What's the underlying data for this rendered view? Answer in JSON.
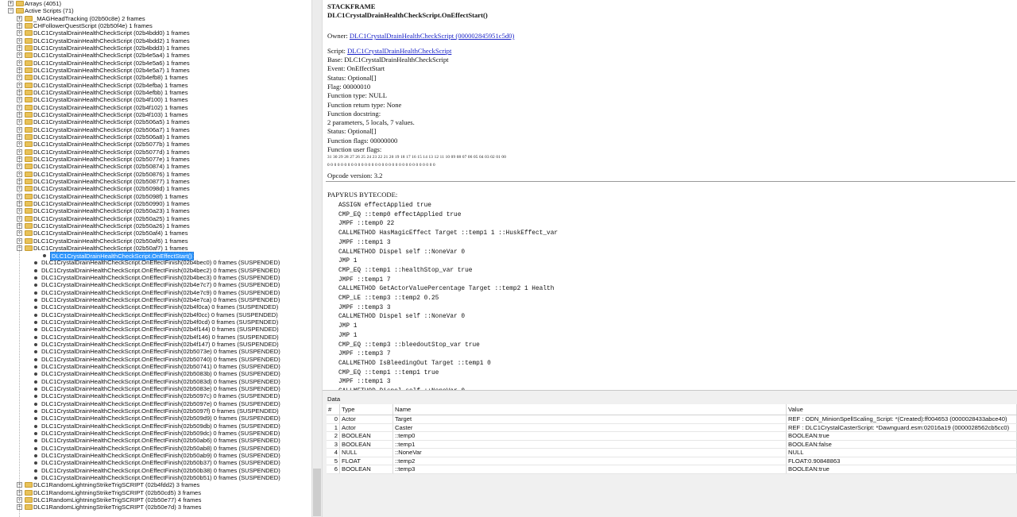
{
  "tree": {
    "rows": [
      {
        "indent": 0,
        "type": "exp-folder",
        "expanded": false,
        "label": "Arrays (4051)"
      },
      {
        "indent": 0,
        "type": "exp-folder",
        "expanded": true,
        "label": "Active Scripts (71)"
      },
      {
        "indent": 1,
        "type": "exp-folder",
        "expanded": false,
        "label": "_MAGHeadTracking (02b50c8e) 2 frames"
      },
      {
        "indent": 1,
        "type": "exp-folder",
        "expanded": false,
        "label": "CHFollowerQuestScript (02b50f4e) 1 frames"
      },
      {
        "indent": 1,
        "type": "exp-folder",
        "expanded": false,
        "label": "DLC1CrystalDrainHealthCheckScript (02b4bdd0) 1 frames"
      },
      {
        "indent": 1,
        "type": "exp-folder",
        "expanded": false,
        "label": "DLC1CrystalDrainHealthCheckScript (02b4bdd2) 1 frames"
      },
      {
        "indent": 1,
        "type": "exp-folder",
        "expanded": false,
        "label": "DLC1CrystalDrainHealthCheckScript (02b4bdd3) 1 frames"
      },
      {
        "indent": 1,
        "type": "exp-folder",
        "expanded": false,
        "label": "DLC1CrystalDrainHealthCheckScript (02b4e5a4) 1 frames"
      },
      {
        "indent": 1,
        "type": "exp-folder",
        "expanded": false,
        "label": "DLC1CrystalDrainHealthCheckScript (02b4e5a6) 1 frames"
      },
      {
        "indent": 1,
        "type": "exp-folder",
        "expanded": false,
        "label": "DLC1CrystalDrainHealthCheckScript (02b4e5a7) 1 frames"
      },
      {
        "indent": 1,
        "type": "exp-folder",
        "expanded": false,
        "label": "DLC1CrystalDrainHealthCheckScript (02b4efb8) 1 frames"
      },
      {
        "indent": 1,
        "type": "exp-folder",
        "expanded": false,
        "label": "DLC1CrystalDrainHealthCheckScript (02b4efba) 1 frames"
      },
      {
        "indent": 1,
        "type": "exp-folder",
        "expanded": false,
        "label": "DLC1CrystalDrainHealthCheckScript (02b4efbb) 1 frames"
      },
      {
        "indent": 1,
        "type": "exp-folder",
        "expanded": false,
        "label": "DLC1CrystalDrainHealthCheckScript (02b4f100) 1 frames"
      },
      {
        "indent": 1,
        "type": "exp-folder",
        "expanded": false,
        "label": "DLC1CrystalDrainHealthCheckScript (02b4f102) 1 frames"
      },
      {
        "indent": 1,
        "type": "exp-folder",
        "expanded": false,
        "label": "DLC1CrystalDrainHealthCheckScript (02b4f103) 1 frames"
      },
      {
        "indent": 1,
        "type": "exp-folder",
        "expanded": false,
        "label": "DLC1CrystalDrainHealthCheckScript (02b506a5) 1 frames"
      },
      {
        "indent": 1,
        "type": "exp-folder",
        "expanded": false,
        "label": "DLC1CrystalDrainHealthCheckScript (02b506a7) 1 frames"
      },
      {
        "indent": 1,
        "type": "exp-folder",
        "expanded": false,
        "label": "DLC1CrystalDrainHealthCheckScript (02b506a8) 1 frames"
      },
      {
        "indent": 1,
        "type": "exp-folder",
        "expanded": false,
        "label": "DLC1CrystalDrainHealthCheckScript (02b5077b) 1 frames"
      },
      {
        "indent": 1,
        "type": "exp-folder",
        "expanded": false,
        "label": "DLC1CrystalDrainHealthCheckScript (02b5077d) 1 frames"
      },
      {
        "indent": 1,
        "type": "exp-folder",
        "expanded": false,
        "label": "DLC1CrystalDrainHealthCheckScript (02b5077e) 1 frames"
      },
      {
        "indent": 1,
        "type": "exp-folder",
        "expanded": false,
        "label": "DLC1CrystalDrainHealthCheckScript (02b50874) 1 frames"
      },
      {
        "indent": 1,
        "type": "exp-folder",
        "expanded": false,
        "label": "DLC1CrystalDrainHealthCheckScript (02b50876) 1 frames"
      },
      {
        "indent": 1,
        "type": "exp-folder",
        "expanded": false,
        "label": "DLC1CrystalDrainHealthCheckScript (02b50877) 1 frames"
      },
      {
        "indent": 1,
        "type": "exp-folder",
        "expanded": false,
        "label": "DLC1CrystalDrainHealthCheckScript (02b5098d) 1 frames"
      },
      {
        "indent": 1,
        "type": "exp-folder",
        "expanded": false,
        "label": "DLC1CrystalDrainHealthCheckScript (02b5098f) 1 frames"
      },
      {
        "indent": 1,
        "type": "exp-folder",
        "expanded": false,
        "label": "DLC1CrystalDrainHealthCheckScript (02b50990) 1 frames"
      },
      {
        "indent": 1,
        "type": "exp-folder",
        "expanded": false,
        "label": "DLC1CrystalDrainHealthCheckScript (02b50a23) 1 frames"
      },
      {
        "indent": 1,
        "type": "exp-folder",
        "expanded": false,
        "label": "DLC1CrystalDrainHealthCheckScript (02b50a25) 1 frames"
      },
      {
        "indent": 1,
        "type": "exp-folder",
        "expanded": false,
        "label": "DLC1CrystalDrainHealthCheckScript (02b50a26) 1 frames"
      },
      {
        "indent": 1,
        "type": "exp-folder",
        "expanded": false,
        "label": "DLC1CrystalDrainHealthCheckScript (02b50af4) 1 frames"
      },
      {
        "indent": 1,
        "type": "exp-folder",
        "expanded": false,
        "label": "DLC1CrystalDrainHealthCheckScript (02b50af6) 1 frames"
      },
      {
        "indent": 1,
        "type": "exp-folder",
        "expanded": true,
        "label": "DLC1CrystalDrainHealthCheckScript (02b50af7) 1 frames"
      },
      {
        "indent": 2,
        "type": "leaf",
        "selected": true,
        "label": "DLC1CrystalDrainHealthCheckScript.OnEffectStart()"
      },
      {
        "indent": 1,
        "type": "leaf",
        "label": "DLC1CrystalDrainHealthCheckScript.OnEffectFinish(02b4bec0) 0 frames (SUSPENDED)"
      },
      {
        "indent": 1,
        "type": "leaf",
        "label": "DLC1CrystalDrainHealthCheckScript.OnEffectFinish(02b4bec2) 0 frames (SUSPENDED)"
      },
      {
        "indent": 1,
        "type": "leaf",
        "label": "DLC1CrystalDrainHealthCheckScript.OnEffectFinish(02b4bec3) 0 frames (SUSPENDED)"
      },
      {
        "indent": 1,
        "type": "leaf",
        "label": "DLC1CrystalDrainHealthCheckScript.OnEffectFinish(02b4e7c7) 0 frames (SUSPENDED)"
      },
      {
        "indent": 1,
        "type": "leaf",
        "label": "DLC1CrystalDrainHealthCheckScript.OnEffectFinish(02b4e7c9) 0 frames (SUSPENDED)"
      },
      {
        "indent": 1,
        "type": "leaf",
        "label": "DLC1CrystalDrainHealthCheckScript.OnEffectFinish(02b4e7ca) 0 frames (SUSPENDED)"
      },
      {
        "indent": 1,
        "type": "leaf",
        "label": "DLC1CrystalDrainHealthCheckScript.OnEffectFinish(02b4f0ca) 0 frames (SUSPENDED)"
      },
      {
        "indent": 1,
        "type": "leaf",
        "label": "DLC1CrystalDrainHealthCheckScript.OnEffectFinish(02b4f0cc) 0 frames (SUSPENDED)"
      },
      {
        "indent": 1,
        "type": "leaf",
        "label": "DLC1CrystalDrainHealthCheckScript.OnEffectFinish(02b4f0cd) 0 frames (SUSPENDED)"
      },
      {
        "indent": 1,
        "type": "leaf",
        "label": "DLC1CrystalDrainHealthCheckScript.OnEffectFinish(02b4f144) 0 frames (SUSPENDED)"
      },
      {
        "indent": 1,
        "type": "leaf",
        "label": "DLC1CrystalDrainHealthCheckScript.OnEffectFinish(02b4f146) 0 frames (SUSPENDED)"
      },
      {
        "indent": 1,
        "type": "leaf",
        "label": "DLC1CrystalDrainHealthCheckScript.OnEffectFinish(02b4f147) 0 frames (SUSPENDED)"
      },
      {
        "indent": 1,
        "type": "leaf",
        "label": "DLC1CrystalDrainHealthCheckScript.OnEffectFinish(02b5073e) 0 frames (SUSPENDED)"
      },
      {
        "indent": 1,
        "type": "leaf",
        "label": "DLC1CrystalDrainHealthCheckScript.OnEffectFinish(02b50740) 0 frames (SUSPENDED)"
      },
      {
        "indent": 1,
        "type": "leaf",
        "label": "DLC1CrystalDrainHealthCheckScript.OnEffectFinish(02b50741) 0 frames (SUSPENDED)"
      },
      {
        "indent": 1,
        "type": "leaf",
        "label": "DLC1CrystalDrainHealthCheckScript.OnEffectFinish(02b5083b) 0 frames (SUSPENDED)"
      },
      {
        "indent": 1,
        "type": "leaf",
        "label": "DLC1CrystalDrainHealthCheckScript.OnEffectFinish(02b5083d) 0 frames (SUSPENDED)"
      },
      {
        "indent": 1,
        "type": "leaf",
        "label": "DLC1CrystalDrainHealthCheckScript.OnEffectFinish(02b5083e) 0 frames (SUSPENDED)"
      },
      {
        "indent": 1,
        "type": "leaf",
        "label": "DLC1CrystalDrainHealthCheckScript.OnEffectFinish(02b5097c) 0 frames (SUSPENDED)"
      },
      {
        "indent": 1,
        "type": "leaf",
        "label": "DLC1CrystalDrainHealthCheckScript.OnEffectFinish(02b5097e) 0 frames (SUSPENDED)"
      },
      {
        "indent": 1,
        "type": "leaf",
        "label": "DLC1CrystalDrainHealthCheckScript.OnEffectFinish(02b5097f) 0 frames (SUSPENDED)"
      },
      {
        "indent": 1,
        "type": "leaf",
        "label": "DLC1CrystalDrainHealthCheckScript.OnEffectFinish(02b509d9) 0 frames (SUSPENDED)"
      },
      {
        "indent": 1,
        "type": "leaf",
        "label": "DLC1CrystalDrainHealthCheckScript.OnEffectFinish(02b509db) 0 frames (SUSPENDED)"
      },
      {
        "indent": 1,
        "type": "leaf",
        "label": "DLC1CrystalDrainHealthCheckScript.OnEffectFinish(02b509dc) 0 frames (SUSPENDED)"
      },
      {
        "indent": 1,
        "type": "leaf",
        "label": "DLC1CrystalDrainHealthCheckScript.OnEffectFinish(02b50ab6) 0 frames (SUSPENDED)"
      },
      {
        "indent": 1,
        "type": "leaf",
        "label": "DLC1CrystalDrainHealthCheckScript.OnEffectFinish(02b50ab8) 0 frames (SUSPENDED)"
      },
      {
        "indent": 1,
        "type": "leaf",
        "label": "DLC1CrystalDrainHealthCheckScript.OnEffectFinish(02b50ab9) 0 frames (SUSPENDED)"
      },
      {
        "indent": 1,
        "type": "leaf",
        "label": "DLC1CrystalDrainHealthCheckScript.OnEffectFinish(02b50b37) 0 frames (SUSPENDED)"
      },
      {
        "indent": 1,
        "type": "leaf",
        "label": "DLC1CrystalDrainHealthCheckScript.OnEffectFinish(02b50b38) 0 frames (SUSPENDED)"
      },
      {
        "indent": 1,
        "type": "leaf",
        "label": "DLC1CrystalDrainHealthCheckScript.OnEffectFinish(02b50b51) 0 frames (SUSPENDED)"
      },
      {
        "indent": 1,
        "type": "exp-folder",
        "expanded": false,
        "label": "DLC1RandomLightningStrikeTrigSCRIPT (02b4fdd2) 3 frames"
      },
      {
        "indent": 1,
        "type": "exp-folder",
        "expanded": false,
        "label": "DLC1RandomLightningStrikeTrigSCRIPT (02b50cd5) 3 frames"
      },
      {
        "indent": 1,
        "type": "exp-folder",
        "expanded": false,
        "label": "DLC1RandomLightningStrikeTrigSCRIPT (02b50e77) 4 frames"
      },
      {
        "indent": 1,
        "type": "exp-folder",
        "expanded": false,
        "label": "DLC1RandomLightningStrikeTrigSCRIPT (02b50e7d) 3 frames"
      }
    ]
  },
  "doc": {
    "heading": "STACKFRAME",
    "title": "DLC1CrystalDrainHealthCheckScript.OnEffectStart()",
    "owner_label": "Owner: ",
    "owner_link": "DLC1CrystalDrainHealthCheckScript (000002845951c5d0)",
    "script_label": "Script: ",
    "script_link": "DLC1CrystalDrainHealthCheckScript",
    "lines": [
      "Base: DLC1CrystalDrainHealthCheckScript",
      "Event: OnEffectStart",
      "Status: Optional[]",
      "Flag: 00000010",
      "Function type: NULL",
      "Function return type: None",
      "Function docstring:",
      "2 parameters, 5 locals, 7 values.",
      "Status: Optional[]",
      "Function flags: 00000000",
      "Function user flags:"
    ],
    "bits_header": "31 30 29 28 27 26 25 24 23 22 21 20 19 18 17 16 15 14 13 12 11 10 09 08 07 06 05 04 03 02 01 00",
    "bits_values": "0  0  0  0  0  0  0  0  0  0  0  0  0  0  0  0  0  0  0  0  0  0  0  0  0  0  0  0  0  0  0  0",
    "opcode": "Opcode version: 3.2",
    "bytecode_title": "PAPYRUS BYTECODE:",
    "code": [
      "ASSIGN effectApplied true",
      "CMP_EQ ::temp0 effectApplied true",
      "JMPF ::temp0 22",
      "CALLMETHOD HasMagicEffect Target ::temp1 1 ::HuskEffect_var",
      "JMPF ::temp1 3",
      "CALLMETHOD Dispel self ::NoneVar 0",
      "JMP 1",
      "CMP_EQ ::temp1 ::healthStop_var true",
      "JMPF ::temp1 7",
      "CALLMETHOD GetActorValuePercentage Target ::temp2 1 Health",
      "CMP_LE ::temp3 ::temp2 0.25",
      "JMPF ::temp3 3",
      "CALLMETHOD Dispel self ::NoneVar 0",
      "JMP 1",
      "JMP 1",
      "CMP_EQ ::temp3 ::bleedoutStop_var true",
      "JMPF ::temp3 7",
      "CALLMETHOD IsBleedingOut Target ::temp1 0",
      "CMP_EQ ::temp1 ::temp1 true",
      "JMPF ::temp1 3",
      "CALLMETHOD Dispel self ::NoneVar 0"
    ]
  },
  "grid": {
    "title": "Data",
    "headers": [
      "#",
      "Type",
      "Name",
      "Value"
    ],
    "rows": [
      [
        "0",
        "Actor",
        "Target",
        "REF : ODN_MinionSpellScaling_Script: *(Created):ff004653 (0000028433abce40)"
      ],
      [
        "1",
        "Actor",
        "Caster",
        "REF : DLC1CrystalCasterScript: *Dawnguard.esm:02016a19 (0000028562cb5cc0)"
      ],
      [
        "2",
        "BOOLEAN",
        "::temp0",
        "BOOLEAN:true"
      ],
      [
        "3",
        "BOOLEAN",
        "::temp1",
        "BOOLEAN:false"
      ],
      [
        "4",
        "NULL",
        "::NoneVar",
        "NULL"
      ],
      [
        "5",
        "FLOAT",
        "::temp2",
        "FLOAT:0.90848863"
      ],
      [
        "6",
        "BOOLEAN",
        "::temp3",
        "BOOLEAN:true"
      ]
    ]
  }
}
